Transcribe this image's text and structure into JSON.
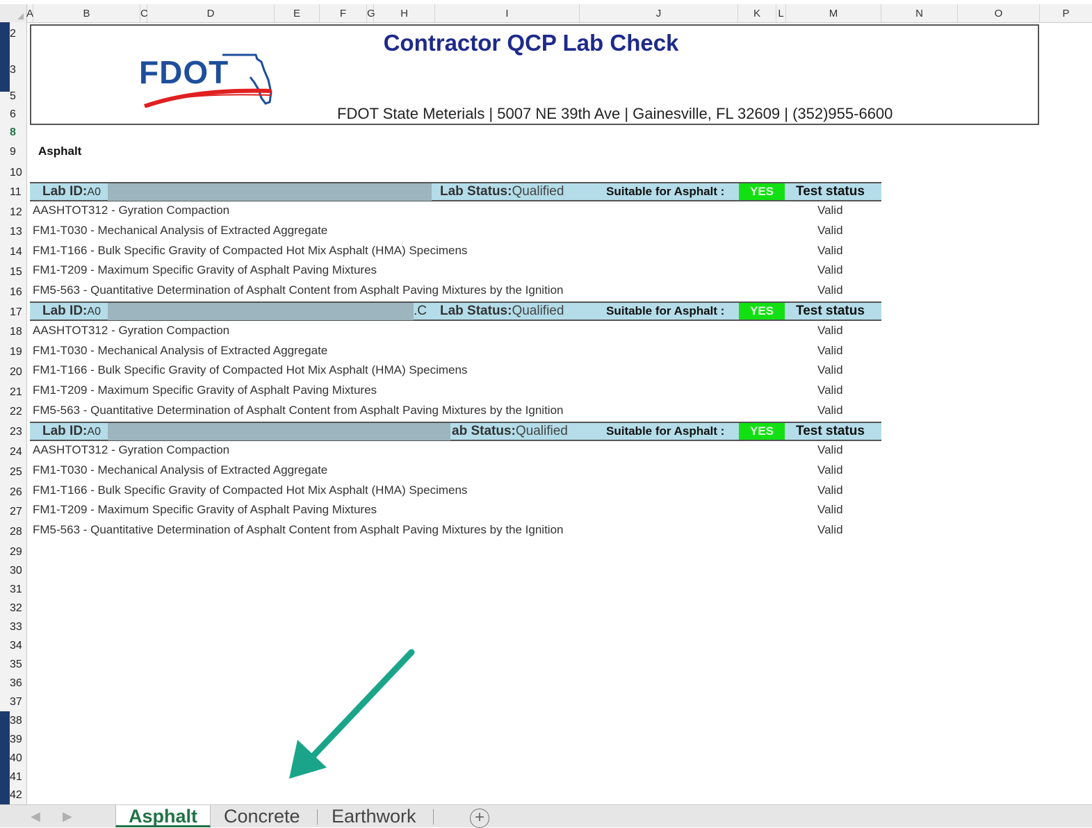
{
  "columns": [
    "A",
    "B",
    "C",
    "D",
    "E",
    "F",
    "G",
    "H",
    "I",
    "J",
    "K",
    "L",
    "M",
    "N",
    "O",
    "P"
  ],
  "rows": [
    "2",
    "3",
    "5",
    "6",
    "8",
    "9",
    "10",
    "11",
    "12",
    "13",
    "14",
    "15",
    "16",
    "17",
    "18",
    "19",
    "20",
    "21",
    "22",
    "23",
    "24",
    "25",
    "26",
    "27",
    "28",
    "29",
    "30",
    "31",
    "32",
    "33",
    "34",
    "35",
    "36",
    "37",
    "38",
    "39",
    "40",
    "41",
    "42"
  ],
  "selected_row": "8",
  "banner": {
    "logo_text": "FDOT",
    "title": "Contractor QCP Lab Check",
    "address": "FDOT State Meterials | 5007 NE 39th Ave | Gainesville, FL 32609 | (352)955-6600"
  },
  "section_title": "Asphalt",
  "labs": [
    {
      "lab_id_label": "Lab ID:",
      "lab_id_value": "A0",
      "status_label": "Lab Status:",
      "status_value": "Qualified",
      "suitable_label": "Suitable for Asphalt :",
      "suitable_value": "YES",
      "test_status_label": "Test status",
      "tests": [
        {
          "name": "AASHTOT312 - Gyration Compaction",
          "status": "Valid"
        },
        {
          "name": "FM1-T030 - Mechanical Analysis of Extracted Aggregate",
          "status": "Valid"
        },
        {
          "name": "FM1-T166 - Bulk Specific Gravity of Compacted Hot Mix Asphalt (HMA) Specimens",
          "status": "Valid"
        },
        {
          "name": "FM1-T209 - Maximum Specific Gravity of Asphalt Paving Mixtures",
          "status": "Valid"
        },
        {
          "name": "FM5-563 - Quantitative Determination of Asphalt Content from Asphalt Paving Mixtures by the Ignition",
          "status": "Valid"
        }
      ]
    },
    {
      "lab_id_label": "Lab ID:",
      "lab_id_value": "A0",
      "trailing_text": ".C",
      "status_label": "Lab Status:",
      "status_value": "Qualified",
      "suitable_label": "Suitable for Asphalt :",
      "suitable_value": "YES",
      "test_status_label": "Test status",
      "tests": [
        {
          "name": "AASHTOT312 - Gyration Compaction",
          "status": "Valid"
        },
        {
          "name": "FM1-T030 - Mechanical Analysis of Extracted Aggregate",
          "status": "Valid"
        },
        {
          "name": "FM1-T166 - Bulk Specific Gravity of Compacted Hot Mix Asphalt (HMA) Specimens",
          "status": "Valid"
        },
        {
          "name": "FM1-T209 - Maximum Specific Gravity of Asphalt Paving Mixtures",
          "status": "Valid"
        },
        {
          "name": "FM5-563 - Quantitative Determination of Asphalt Content from Asphalt Paving Mixtures by the Ignition",
          "status": "Valid"
        }
      ]
    },
    {
      "lab_id_label": "Lab ID:",
      "lab_id_value": "A0",
      "status_label": "ab Status:",
      "status_value": "Qualified",
      "suitable_label": "Suitable for Asphalt :",
      "suitable_value": "YES",
      "test_status_label": "Test status",
      "tests": [
        {
          "name": "AASHTOT312 - Gyration Compaction",
          "status": "Valid"
        },
        {
          "name": "FM1-T030 - Mechanical Analysis of Extracted Aggregate",
          "status": "Valid"
        },
        {
          "name": "FM1-T166 - Bulk Specific Gravity of Compacted Hot Mix Asphalt (HMA) Specimens",
          "status": "Valid"
        },
        {
          "name": "FM1-T209 - Maximum Specific Gravity of Asphalt Paving Mixtures",
          "status": "Valid"
        },
        {
          "name": "FM5-563 - Quantitative Determination of Asphalt Content from Asphalt Paving Mixtures by the Ignition",
          "status": "Valid"
        }
      ]
    }
  ],
  "sheet_tabs": [
    {
      "label": "Asphalt",
      "active": true
    },
    {
      "label": "Concrete",
      "active": false
    },
    {
      "label": "Earthwork",
      "active": false
    }
  ],
  "icons": {
    "add_sheet": "plus-circle-icon",
    "prev_sheet": "triangle-left-icon",
    "next_sheet": "triangle-right-icon",
    "annotation_arrow": "arrow-down-left-icon"
  },
  "colors": {
    "header_fill": "#b4dde9",
    "yes_fill": "#12e012",
    "title": "#1e2a8a",
    "active_tab": "#217346",
    "arrow": "#1aa58a"
  }
}
